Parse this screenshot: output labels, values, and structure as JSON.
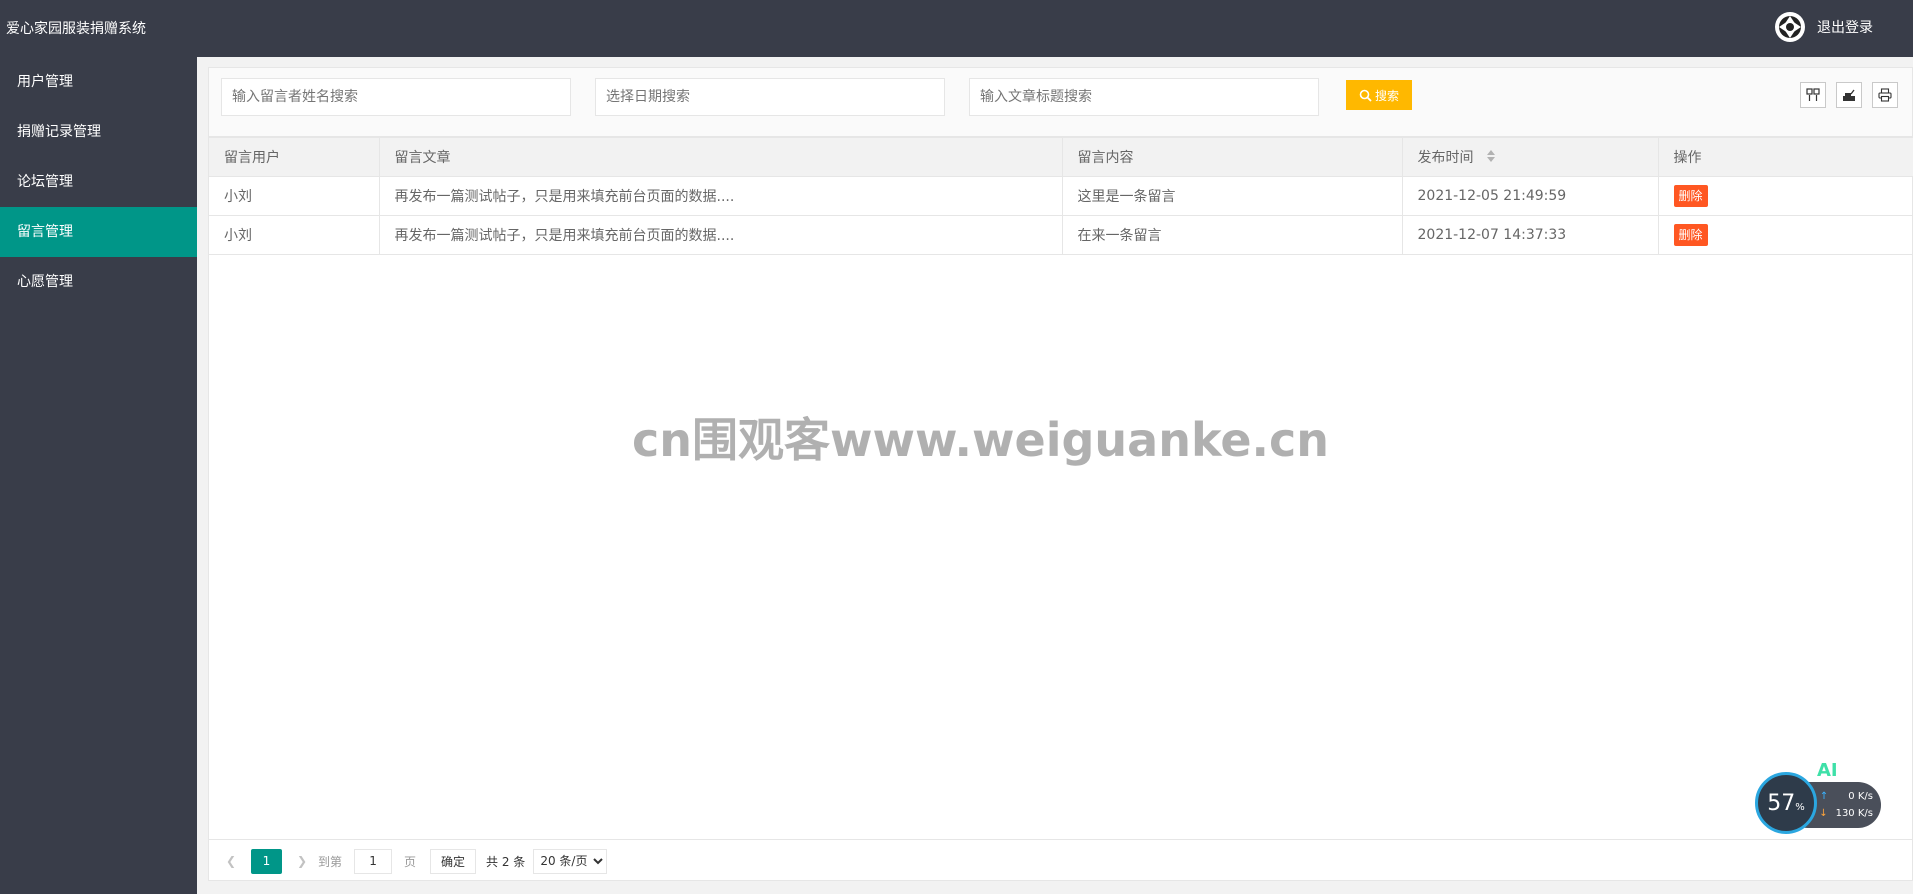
{
  "header": {
    "title": "爱心家园服装捐赠系统",
    "logout_label": "退出登录"
  },
  "sidebar": {
    "items": [
      {
        "label": "用户管理",
        "active": false
      },
      {
        "label": "捐赠记录管理",
        "active": false
      },
      {
        "label": "论坛管理",
        "active": false
      },
      {
        "label": "留言管理",
        "active": true
      },
      {
        "label": "心愿管理",
        "active": false
      }
    ]
  },
  "toolbar": {
    "name_placeholder": "输入留言者姓名搜索",
    "date_placeholder": "选择日期搜索",
    "title_placeholder": "输入文章标题搜索",
    "search_label": "搜索",
    "tools": [
      "columns-icon",
      "export-icon",
      "print-icon"
    ]
  },
  "table": {
    "columns": [
      "留言用户",
      "留言文章",
      "留言内容",
      "发布时间",
      "操作"
    ],
    "rows": [
      {
        "user": "小刘",
        "article": "再发布一篇测试帖子，只是用来填充前台页面的数据....",
        "content": "这里是一条留言",
        "time": "2021-12-05 21:49:59",
        "action": "删除"
      },
      {
        "user": "小刘",
        "article": "再发布一篇测试帖子，只是用来填充前台页面的数据....",
        "content": "在来一条留言",
        "time": "2021-12-07 14:37:33",
        "action": "删除"
      }
    ]
  },
  "watermark": "cn围观客www.weiguanke.cn",
  "pager": {
    "current_page": "1",
    "goto_label": "到第",
    "goto_value": "1",
    "page_label": "页",
    "ok_label": "确定",
    "total_label": "共 2 条",
    "page_size": "20 条/页"
  },
  "speed_widget": {
    "ai_label": "AI",
    "percent": "57",
    "percent_unit": "%",
    "upload": "0",
    "upload_unit": "K/s",
    "download": "130",
    "download_unit": "K/s"
  },
  "colors": {
    "header_bg": "#393d49",
    "sidebar_active": "#009688",
    "search_button": "#ffb800",
    "delete_button": "#ff5722"
  }
}
